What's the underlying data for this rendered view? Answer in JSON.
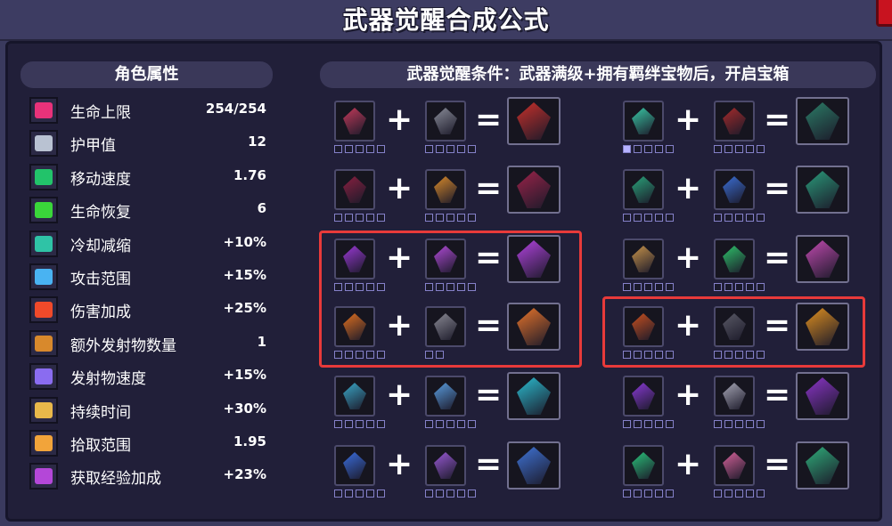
{
  "title": "武器觉醒合成公式",
  "attributes": {
    "header": "角色属性",
    "items": [
      {
        "icon": "heart-icon",
        "color": "#e8327a",
        "label": "生命上限",
        "value": "254/254"
      },
      {
        "icon": "armor-icon",
        "color": "#b9c2d2",
        "label": "护甲值",
        "value": "12"
      },
      {
        "icon": "boots-icon",
        "color": "#22c36a",
        "label": "移动速度",
        "value": "1.76"
      },
      {
        "icon": "green-cross-icon",
        "color": "#3ad63a",
        "label": "生命恢复",
        "value": "6"
      },
      {
        "icon": "hourglass-icon",
        "color": "#2fc3a6",
        "label": "冷却减缩",
        "value": "+10%"
      },
      {
        "icon": "target-icon",
        "color": "#49b3f2",
        "label": "攻击范围",
        "value": "+15%"
      },
      {
        "icon": "bell-icon",
        "color": "#f04a2a",
        "label": "伤害加成",
        "value": "+25%"
      },
      {
        "icon": "multi-arrow-icon",
        "color": "#d8892c",
        "label": "额外发射物数量",
        "value": "1"
      },
      {
        "icon": "projectile-speed-icon",
        "color": "#8a6cf0",
        "label": "发射物速度",
        "value": "+15%"
      },
      {
        "icon": "candle-icon",
        "color": "#e9b84a",
        "label": "持续时间",
        "value": "+30%"
      },
      {
        "icon": "magnet-icon",
        "color": "#f2a43a",
        "label": "拾取范围",
        "value": "1.95"
      },
      {
        "icon": "exp-icon",
        "color": "#b447d8",
        "label": "获取经验加成",
        "value": "+23%"
      }
    ]
  },
  "conditions": {
    "header": "武器觉醒条件：武器满级+拥有羁绊宝物后，开启宝箱"
  },
  "symbols": {
    "plus": "+",
    "equals": "="
  },
  "recipes": [
    {
      "a": {
        "icon": "dark-crystal-icon",
        "color": "#c43a5a",
        "stars": 5,
        "filled": 0
      },
      "b": {
        "icon": "knight-helmet-icon",
        "color": "#8a8d99",
        "stars": 5,
        "filled": 0
      },
      "r": {
        "icon": "awakened-crystal-icon",
        "color": "#c9302a"
      }
    },
    {
      "a": {
        "icon": "ghost-wolf-icon",
        "color": "#39c9a6",
        "stars": 5,
        "filled": 1
      },
      "b": {
        "icon": "dark-amulet-icon",
        "color": "#a72b2b",
        "stars": 5,
        "filled": 0
      },
      "r": {
        "icon": "awakened-wolf-icon",
        "color": "#2b7d67"
      }
    },
    {
      "a": {
        "icon": "shadow-bow-icon",
        "color": "#8a2040",
        "stars": 5,
        "filled": 0
      },
      "b": {
        "icon": "gold-helmet-icon",
        "color": "#d88a2a",
        "stars": 5,
        "filled": 0
      },
      "r": {
        "icon": "awakened-bow-icon",
        "color": "#9c2349"
      }
    },
    {
      "a": {
        "icon": "leaf-blade-icon",
        "color": "#2aa47a",
        "stars": 5,
        "filled": 0
      },
      "b": {
        "icon": "blue-flask-icon",
        "color": "#3b6fd6",
        "stars": 5,
        "filled": 0
      },
      "r": {
        "icon": "awakened-leaves-icon",
        "color": "#2a9b7a"
      }
    },
    {
      "a": {
        "icon": "purple-spear-icon",
        "color": "#9b39d6",
        "stars": 5,
        "filled": 0
      },
      "b": {
        "icon": "demon-mask-icon",
        "color": "#b04ad6",
        "stars": 5,
        "filled": 0
      },
      "r": {
        "icon": "awakened-spear-icon",
        "color": "#b343e0"
      }
    },
    {
      "a": {
        "icon": "golden-bear-icon",
        "color": "#c8944a",
        "stars": 5,
        "filled": 0
      },
      "b": {
        "icon": "green-whip-icon",
        "color": "#2ec36a",
        "stars": 5,
        "filled": 0
      },
      "r": {
        "icon": "awakened-bear-icon",
        "color": "#c24ab0"
      }
    },
    {
      "a": {
        "icon": "fire-torch-icon",
        "color": "#e0701f",
        "stars": 5,
        "filled": 0
      },
      "b": {
        "icon": "stone-lantern-icon",
        "color": "#8a8a94",
        "stars": 2,
        "filled": 0
      },
      "r": {
        "icon": "awakened-fire-icon",
        "color": "#e8742a"
      }
    },
    {
      "a": {
        "icon": "flame-orb-icon",
        "color": "#c8501f",
        "stars": 5,
        "filled": 0
      },
      "b": {
        "icon": "dark-cloak-icon",
        "color": "#5a5a66",
        "stars": 5,
        "filled": 0
      },
      "r": {
        "icon": "awakened-flame-staff-icon",
        "color": "#e0901f"
      }
    },
    {
      "a": {
        "icon": "blue-vial-icon",
        "color": "#3aa8c8",
        "stars": 5,
        "filled": 0
      },
      "b": {
        "icon": "ice-armor-icon",
        "color": "#5a9ee0",
        "stars": 5,
        "filled": 0
      },
      "r": {
        "icon": "awakened-ice-orb-icon",
        "color": "#2bbdd0"
      }
    },
    {
      "a": {
        "icon": "bat-wing-icon",
        "color": "#8a3ad6",
        "stars": 5,
        "filled": 0
      },
      "b": {
        "icon": "silver-claw-icon",
        "color": "#a7a7b6",
        "stars": 5,
        "filled": 0
      },
      "r": {
        "icon": "awakened-bat-icon",
        "color": "#8c35c9"
      }
    },
    {
      "a": {
        "icon": "blue-fish-icon",
        "color": "#3a6ee0",
        "stars": 5,
        "filled": 0
      },
      "b": {
        "icon": "purple-ring-icon",
        "color": "#9a5ad6",
        "stars": 5,
        "filled": 0
      },
      "r": {
        "icon": "awakened-fish-icon",
        "color": "#3f74d8"
      }
    },
    {
      "a": {
        "icon": "jade-coil-icon",
        "color": "#2ac37a",
        "stars": 5,
        "filled": 0
      },
      "b": {
        "icon": "rainbow-gem-icon",
        "color": "#d6629a",
        "stars": 5,
        "filled": 0
      },
      "r": {
        "icon": "awakened-jade-icon",
        "color": "#2fae7a"
      }
    }
  ]
}
